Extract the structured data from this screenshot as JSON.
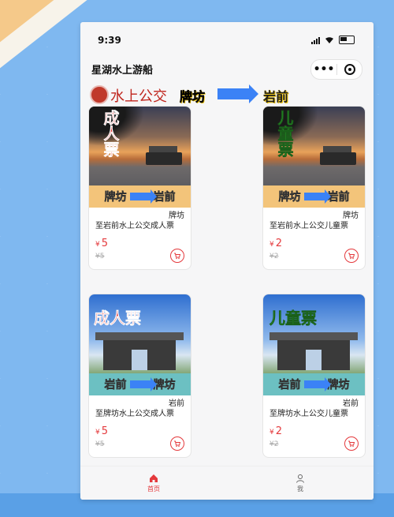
{
  "status_bar": {
    "time": "9:39"
  },
  "nav": {
    "title": "星湖水上游船"
  },
  "banner": {
    "title": "水上公交",
    "from": "牌坊",
    "to": "岩前"
  },
  "products": [
    {
      "big_text": "成人票",
      "strip_from": "牌坊",
      "strip_to": "岩前",
      "route": "牌坊",
      "name": "至岩前水上公交成人票",
      "currency": "¥",
      "price": "5",
      "original_price": "¥5"
    },
    {
      "big_text": "儿童票",
      "strip_from": "牌坊",
      "strip_to": "岩前",
      "route": "牌坊",
      "name": "至岩前水上公交儿童票",
      "currency": "¥",
      "price": "2",
      "original_price": "¥2"
    },
    {
      "big_text": "成人票",
      "strip_from": "岩前",
      "strip_to": "牌坊",
      "route": "岩前",
      "name": "至牌坊水上公交成人票",
      "currency": "¥",
      "price": "5",
      "original_price": "¥5"
    },
    {
      "big_text": "儿童票",
      "strip_from": "岩前",
      "strip_to": "牌坊",
      "route": "岩前",
      "name": "至牌坊水上公交儿童票",
      "currency": "¥",
      "price": "2",
      "original_price": "¥2"
    }
  ],
  "tabs": [
    {
      "label": "首页",
      "icon": "home-icon",
      "active": true
    },
    {
      "label": "我",
      "icon": "user-icon",
      "active": false
    }
  ],
  "colors": {
    "accent": "#e4393c",
    "arrow": "#3b82f6",
    "adult_text": "#e02020",
    "child_text": "#3ec93e"
  }
}
